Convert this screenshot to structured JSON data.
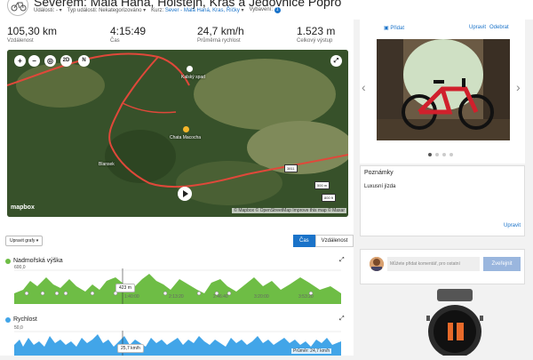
{
  "header": {
    "title": "Severem: Malá Haná, Holštejn, Kras a Jedovnice Popro",
    "meta": [
      {
        "label": "Události:",
        "value": "-"
      },
      {
        "label": "Typ události:",
        "value": "Nekategorizováno"
      },
      {
        "label": "Kurz:",
        "value": "Sever - Malá Haná, Kras, Říčky"
      },
      {
        "label": "Vybavení:",
        "value": "1"
      }
    ]
  },
  "stats": [
    {
      "value": "105,30 km",
      "label": "Vzdálenost"
    },
    {
      "value": "4:15:49",
      "label": "Čas"
    },
    {
      "value": "24,7 km/h",
      "label": "Průměrná rychlost"
    },
    {
      "value": "1.523 m",
      "label": "Celkový výstup"
    }
  ],
  "map": {
    "controls": [
      "+",
      "−",
      "◎",
      "2D",
      "N"
    ],
    "places": [
      "Kalský spad",
      "Chata Macocha",
      "Blansek"
    ],
    "road": "3811",
    "scale_m": "500 m",
    "scale_ft": "800 ft",
    "logo": "mapbox",
    "attribution": "© Mapbox © OpenStreetMap Improve this map © Maxar"
  },
  "controls": {
    "edit_charts": "Upravit grafy ▾",
    "toggle_time": "Čas",
    "toggle_distance": "Vzdálenost"
  },
  "elevation": {
    "title": "Nadmořská výška",
    "ymax": "600,0",
    "tooltip": "423 m",
    "time_ticks": [
      "1:40:00",
      "2:13:20",
      "2:46:40",
      "3:20:00",
      "3:53:20"
    ]
  },
  "speed": {
    "title": "Rychlost",
    "ymax": "50,0",
    "tooltip": "25,7 km/h",
    "avg": "Průměr: 24,7 km/h"
  },
  "right": {
    "add_label": "Přidat",
    "edit_label": "Upravit",
    "remove_label": "Odebrat",
    "notes_title": "Poznámky",
    "notes_text": "Luxusní jízda",
    "notes_edit": "Upravit",
    "comment_placeholder": "Můžete přidat komentář, pro ostatní",
    "comment_button": "Zveřejnit"
  },
  "colors": {
    "elevation": "#6ebd45",
    "speed": "#42a5e8",
    "route": "#e0483a",
    "accent": "#1a73c9"
  }
}
